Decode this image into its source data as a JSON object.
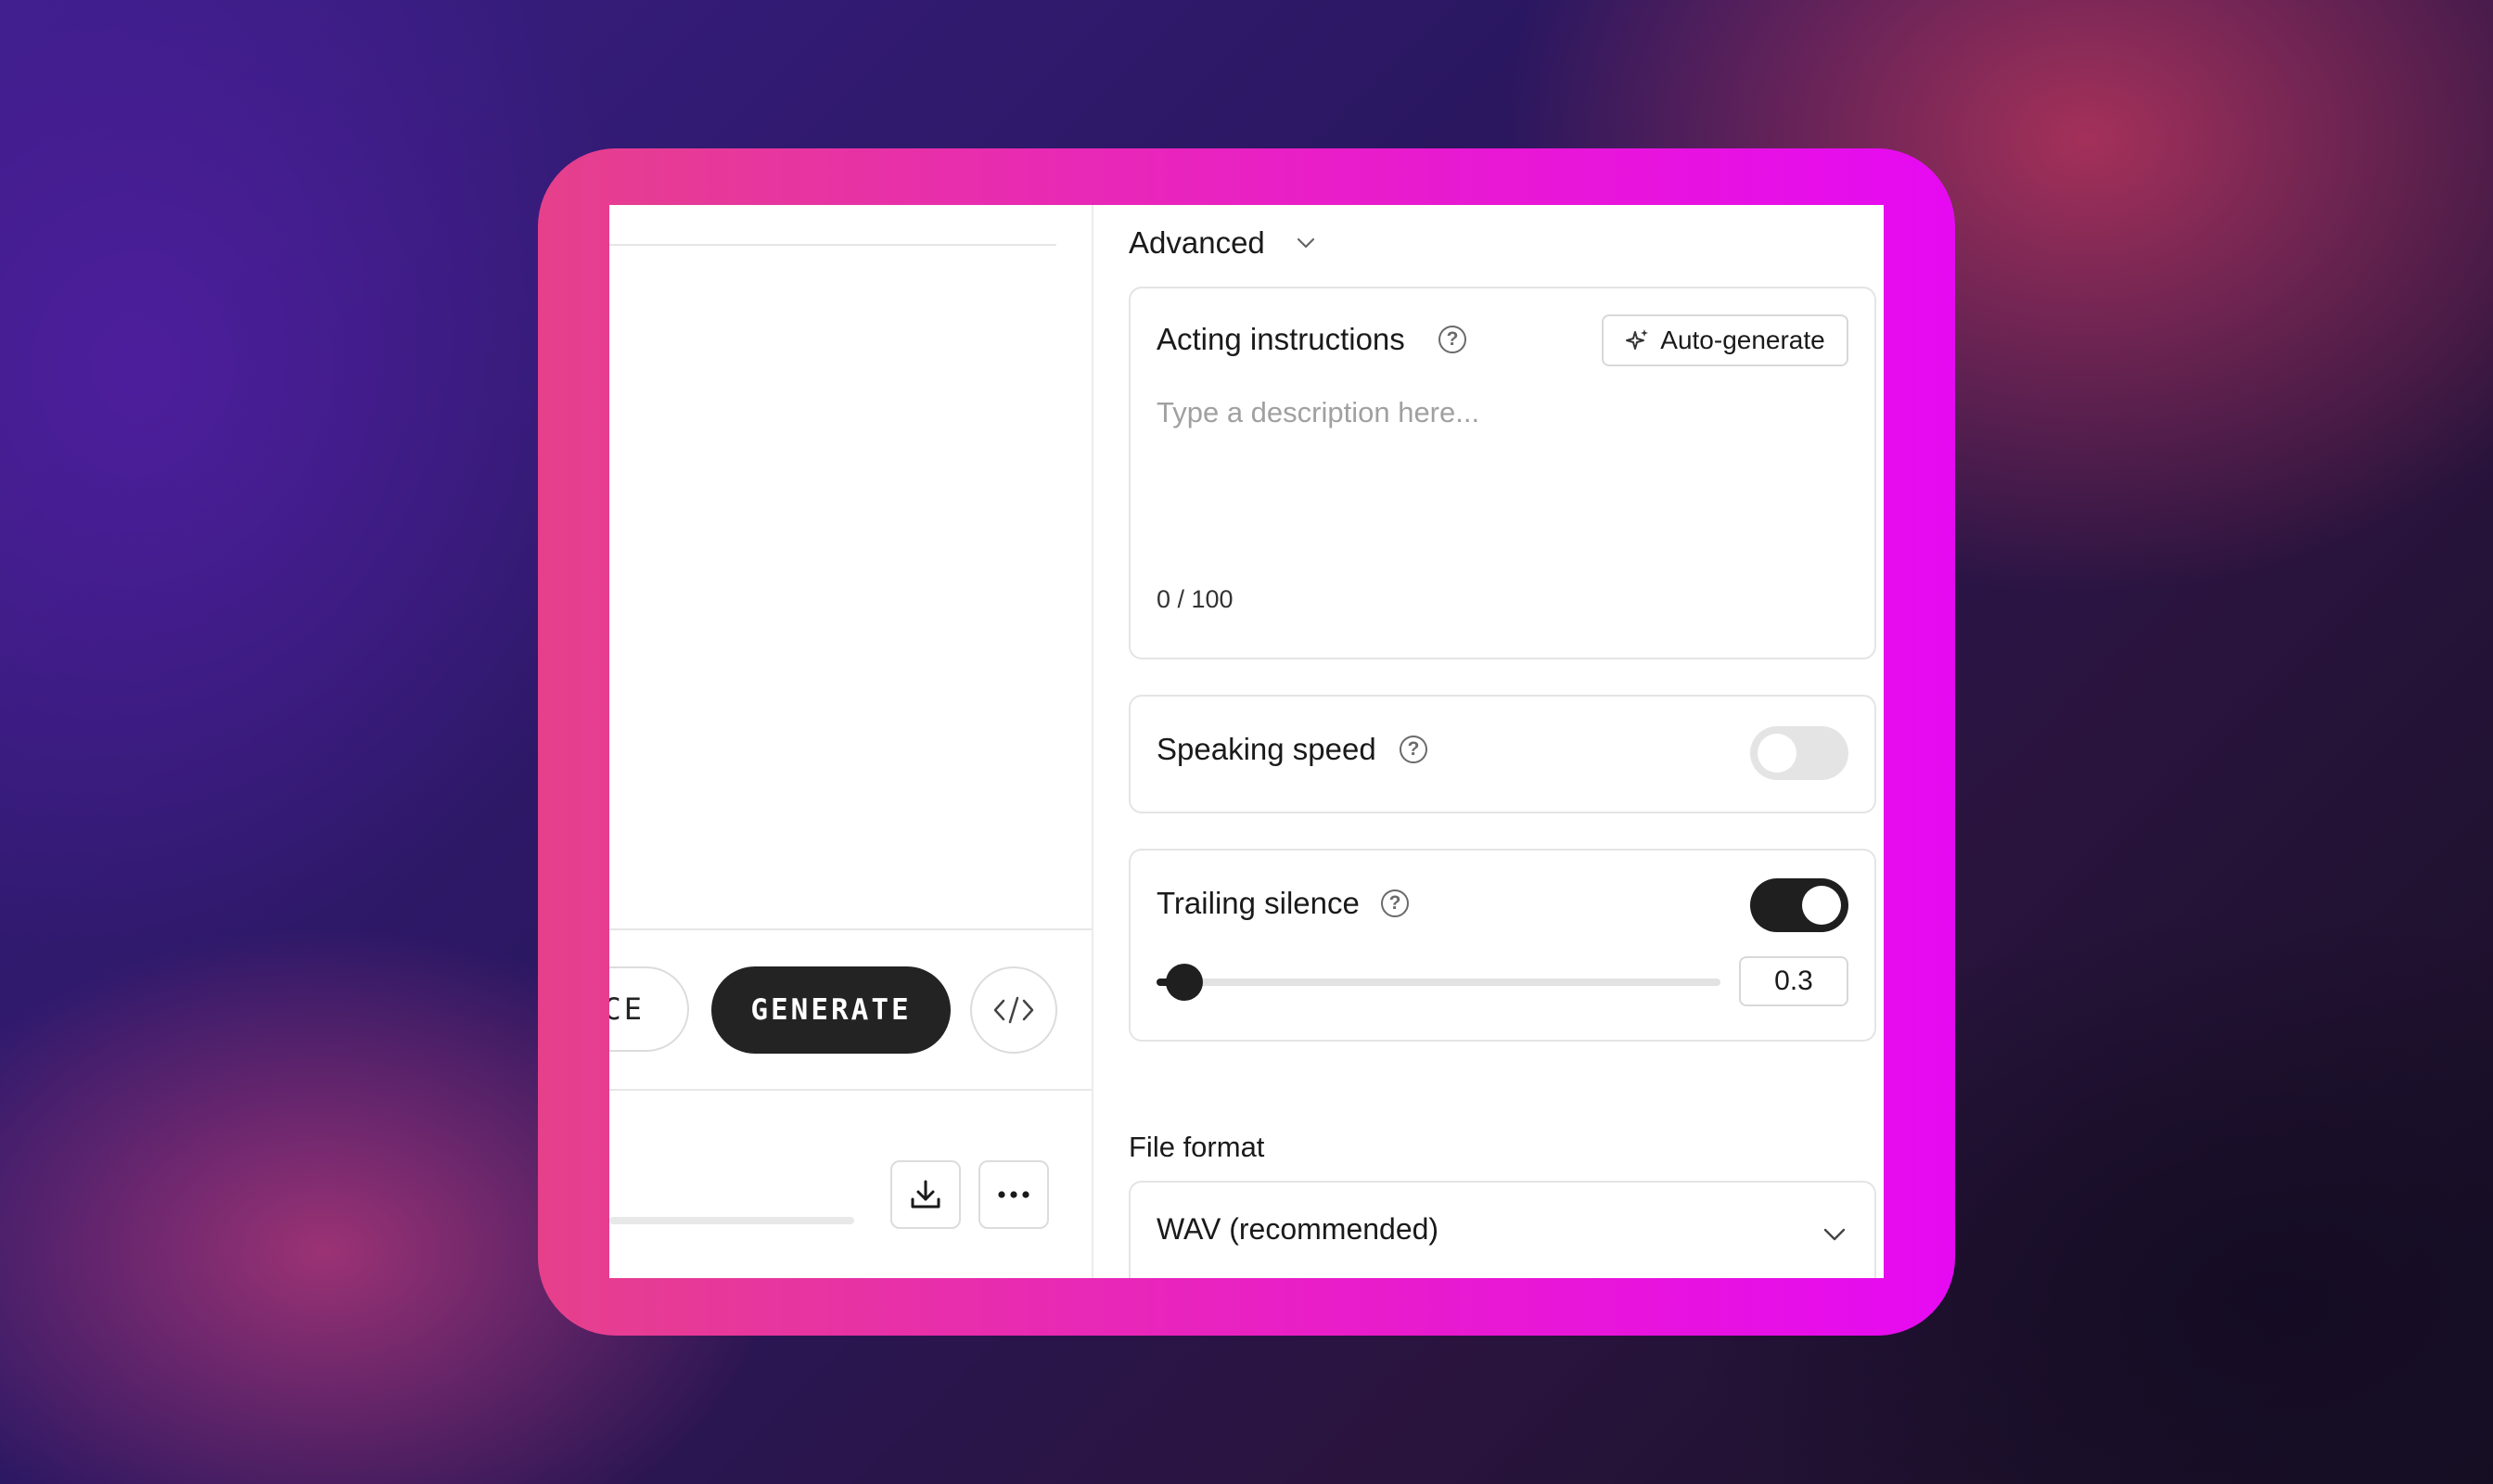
{
  "left": {
    "partial_button_label": "CE",
    "generate_label": "GENERATE"
  },
  "advanced": {
    "title": "Advanced"
  },
  "acting": {
    "label": "Acting instructions",
    "help": "?",
    "auto_generate_label": "Auto-generate",
    "placeholder": "Type a description here...",
    "counter": "0 / 100"
  },
  "speaking_speed": {
    "label": "Speaking speed",
    "help": "?",
    "enabled": false
  },
  "trailing_silence": {
    "label": "Trailing silence",
    "help": "?",
    "enabled": true,
    "slider_fraction": 0.05,
    "value": "0.3"
  },
  "file_format": {
    "label": "File format",
    "selected": "WAV (recommended)"
  },
  "colors": {
    "frame_start": "#e6408c",
    "frame_end": "#e60af2",
    "button_dark": "#232323",
    "toggle_off": "#e4e4e4",
    "toggle_on": "#1f1f1f"
  }
}
